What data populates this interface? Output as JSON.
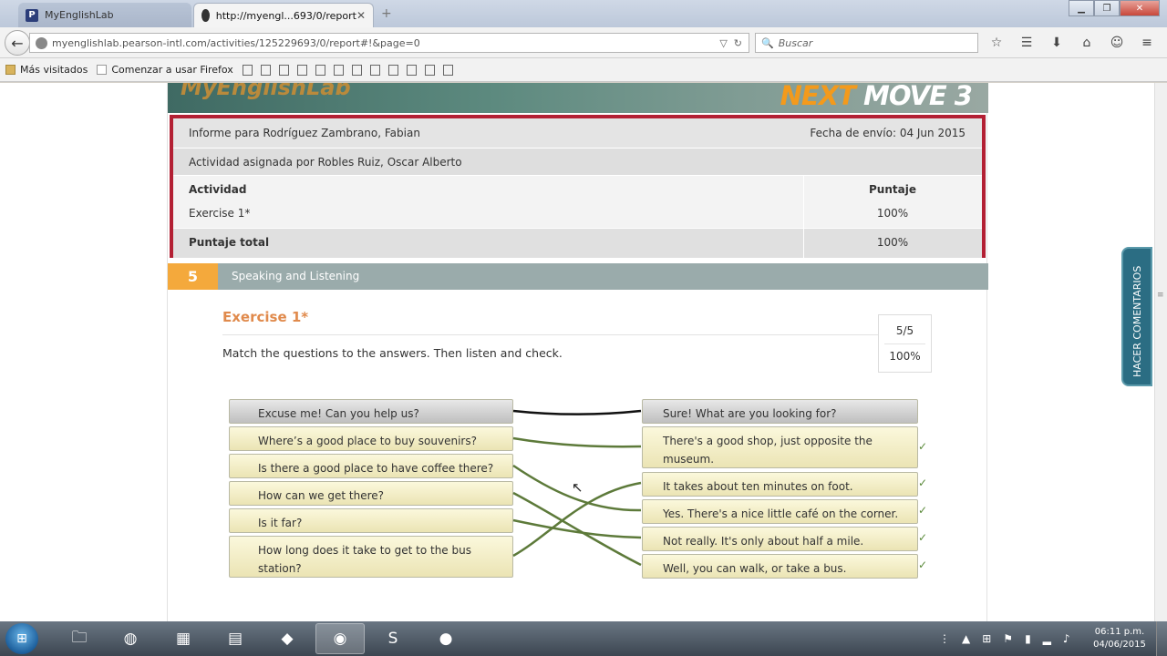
{
  "browser": {
    "tabs": [
      {
        "label": "MyEnglishLab",
        "favicon": "P"
      },
      {
        "label": "http://myengl...693/0/report"
      }
    ],
    "url": "myenglishlab.pearson-intl.com/activities/125229693/0/report#!&page=0",
    "search_placeholder": "Buscar",
    "bookmarks": [
      {
        "label": "Más visitados"
      },
      {
        "label": "Comenzar a usar Firefox"
      }
    ],
    "empty_bookmark_count": 12
  },
  "banner": {
    "logo": "MyEnglishLab",
    "brand_next": "NEXT",
    "brand_move": "MOVE 3"
  },
  "report": {
    "student": "Informe para Rodríguez Zambrano, Fabian",
    "sent_date": "Fecha de envío: 04 Jun 2015",
    "assigned_by": "Actividad asignada por Robles Ruiz, Oscar Alberto",
    "col_activity": "Actividad",
    "col_score": "Puntaje",
    "activity_name": "Exercise 1*",
    "activity_score": "100%",
    "total_label": "Puntaje total",
    "total_score": "100%"
  },
  "section": {
    "number": "5",
    "title": "Speaking and Listening"
  },
  "exercise": {
    "title": "Exercise 1*",
    "instructions": "Match the questions to the answers. Then listen and check.",
    "score_fraction": "5/5",
    "score_percent": "100%",
    "questions": [
      "Excuse me! Can you help us?",
      "Where’s a good place to buy souvenirs?",
      "Is there a good place to have coffee there?",
      "How can we get there?",
      "Is it far?",
      "How long does it take to get to the bus station?"
    ],
    "answers": [
      "Sure! What are you looking for?",
      "There's a good shop, just opposite the museum.",
      "It takes about ten minutes on foot.",
      "Yes. There's a nice little café on the corner.",
      "Not really. It's only about half a mile.",
      "Well, you can walk, or take a bus."
    ],
    "checkmark": "✓",
    "line_color": "#5d7a3a",
    "example_line_color": "#111111"
  },
  "feedback_tab": "HACER COMENTARIOS",
  "taskbar": {
    "time": "06:11 p.m.",
    "date": "04/06/2015"
  }
}
